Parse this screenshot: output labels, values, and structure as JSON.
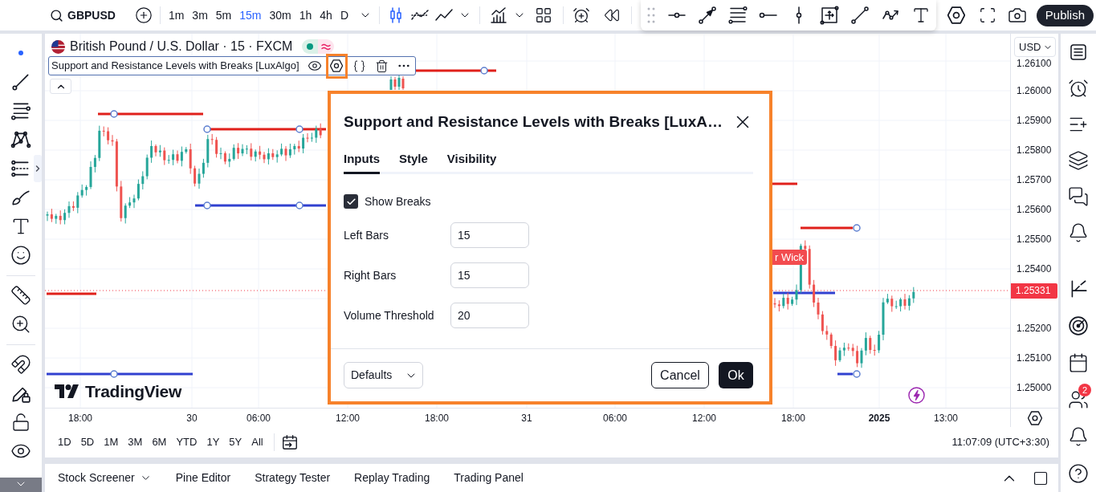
{
  "top_toolbar": {
    "symbol": "GBPUSD",
    "intervals": [
      {
        "label": "1m",
        "selected": false
      },
      {
        "label": "3m",
        "selected": false
      },
      {
        "label": "5m",
        "selected": false
      },
      {
        "label": "15m",
        "selected": true
      },
      {
        "label": "30m",
        "selected": false
      },
      {
        "label": "1h",
        "selected": false
      },
      {
        "label": "4h",
        "selected": false
      },
      {
        "label": "D",
        "selected": false
      }
    ],
    "publish": "Publish"
  },
  "chart": {
    "title": "British Pound / U.S. Dollar · 15 · FXCM",
    "indicator": "Support and Resistance Levels with Breaks [LuxAlgo]",
    "break_label": "r Wick",
    "logo": "TradingView",
    "currency": "USD",
    "price_labels": [
      "1.26100",
      "1.26000",
      "1.25900",
      "1.25800",
      "1.25700",
      "1.25600",
      "1.25500",
      "1.25400",
      "1.25200",
      "1.25100",
      "1.25000"
    ],
    "last_price": "1.25331",
    "time_labels": [
      {
        "label": "18:00",
        "kind": "tick"
      },
      {
        "label": "30",
        "kind": "tick"
      },
      {
        "label": "06:00",
        "kind": "tick"
      },
      {
        "label": "12:00",
        "kind": "tick"
      },
      {
        "label": "18:00",
        "kind": "tick"
      },
      {
        "label": "31",
        "kind": "tick"
      },
      {
        "label": "06:00",
        "kind": "tick"
      },
      {
        "label": "12:00",
        "kind": "tick"
      },
      {
        "label": "18:00",
        "kind": "tick"
      },
      {
        "label": "2025",
        "kind": "year"
      },
      {
        "label": "13:00",
        "kind": "tick"
      }
    ],
    "ranges": [
      "1D",
      "5D",
      "1M",
      "3M",
      "6M",
      "YTD",
      "1Y",
      "5Y",
      "All"
    ],
    "clock": "11:07:09 (UTC+3:30)"
  },
  "dialog": {
    "title": "Support and Resistance Levels with Breaks [LuxA…",
    "tabs": [
      {
        "label": "Inputs",
        "selected": true
      },
      {
        "label": "Style",
        "selected": false
      },
      {
        "label": "Visibility",
        "selected": false
      }
    ],
    "checkbox": {
      "label": "Show Breaks",
      "checked": true
    },
    "fields": [
      {
        "label": "Left Bars",
        "value": "15"
      },
      {
        "label": "Right Bars",
        "value": "15"
      },
      {
        "label": "Volume Threshold",
        "value": "20"
      }
    ],
    "defaults": "Defaults",
    "cancel": "Cancel",
    "ok": "Ok"
  },
  "bottom_panel": {
    "tabs": [
      {
        "label": "Stock Screener",
        "menu": true
      },
      {
        "label": "Pine Editor",
        "menu": false
      },
      {
        "label": "Strategy Tester",
        "menu": false
      },
      {
        "label": "Replay Trading",
        "menu": false
      },
      {
        "label": "Trading Panel",
        "menu": false
      }
    ]
  },
  "right_sidebar": {
    "badge": "2"
  }
}
